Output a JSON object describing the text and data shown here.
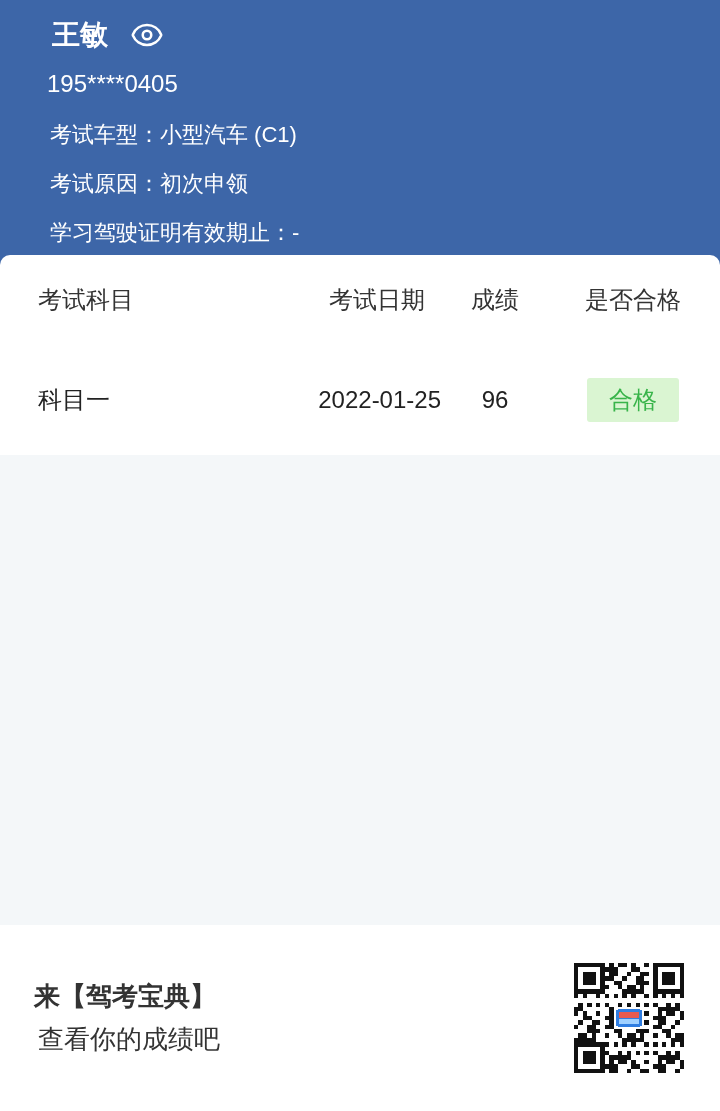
{
  "profile": {
    "name": "王敏",
    "phone": "195****0405",
    "fields": [
      {
        "label": "考试车型：",
        "value": "小型汽车 (C1)"
      },
      {
        "label": "考试原因：",
        "value": "初次申领"
      },
      {
        "label": "学习驾驶证明有效期止：",
        "value": "-"
      }
    ]
  },
  "table": {
    "columns": [
      "考试科目",
      "考试日期",
      "成绩",
      "是否合格"
    ],
    "rows": [
      {
        "subject": "科目一",
        "date": "2022-01-25",
        "score": "96",
        "result": "合格",
        "passed": true
      }
    ]
  },
  "footer": {
    "line_1": "来【驾考宝典】",
    "line_2": "查看你的成绩吧"
  }
}
